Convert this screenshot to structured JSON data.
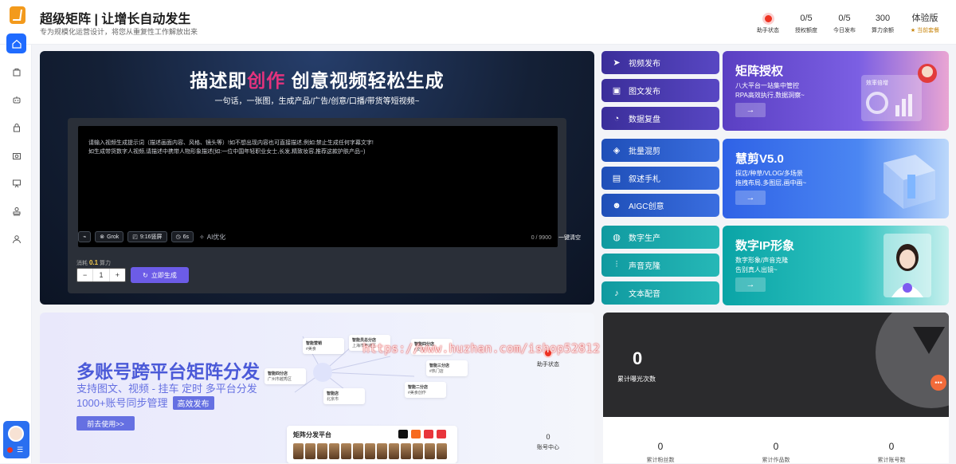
{
  "header": {
    "title": "超级矩阵 | 让增长自动发生",
    "subtitle": "专为规模化运营设计，将您从重复性工作解放出来",
    "stats": [
      {
        "value": "",
        "label": "助手状态"
      },
      {
        "value": "0/5",
        "label": "授权额度"
      },
      {
        "value": "0/5",
        "label": "今日发布"
      },
      {
        "value": "300",
        "label": "算力余额"
      },
      {
        "value": "体验版",
        "label": "当前套餐"
      }
    ]
  },
  "sidebar": {
    "icons": [
      "home-icon",
      "bag-icon",
      "robot-icon",
      "lock-icon",
      "camera-icon",
      "presentation-icon",
      "stamp-icon",
      "user-icon"
    ],
    "menu_glyph": "☰"
  },
  "hero": {
    "title_before": "描述即",
    "title_highlight": "创作",
    "title_after": " 创意视频轻松生成",
    "subtitle": "一句话，一张图，生成产品/广告/创意/口播/带货等短视频~",
    "prompt_line1": "请输入视频生成提示词（描述画面内容、风格、镜头等）!如不想出现内容也可直接描述,例如:禁止生成任何字幕文字!",
    "prompt_line2": "如生成带货数字人视频,请描述中携带人物形象描述(如:一位中国年轻职业女士,长发,精致妆容,推荐这款护肤产品~)",
    "count": "0 / 9900",
    "tools": {
      "model": "Grok",
      "ratio": "9:16竖屏",
      "duration": "6s",
      "ai": "AI优化"
    },
    "clear": "一键清空",
    "cost_prefix": "消耗",
    "cost_value": "0.1",
    "cost_suffix": "算力",
    "qty": "1",
    "minus": "−",
    "plus": "+",
    "generate": "立即生成"
  },
  "features": [
    {
      "label": "视频发布",
      "icon": "send-icon"
    },
    {
      "label": "图文发布",
      "icon": "image-icon"
    },
    {
      "label": "数据复盘",
      "icon": "chart-icon"
    },
    {
      "label": "批量混剪",
      "icon": "layers-icon"
    },
    {
      "label": "叙述手札",
      "icon": "notebook-icon"
    },
    {
      "label": "AIGC创意",
      "icon": "discord-icon"
    },
    {
      "label": "数字生产",
      "icon": "globe-icon"
    },
    {
      "label": "声音克隆",
      "icon": "waveform-icon"
    },
    {
      "label": "文本配音",
      "icon": "microphone-icon"
    }
  ],
  "promos": [
    {
      "title": "矩阵授权",
      "line1": "八大平台一站集中管控",
      "line2": "RPA高效执行,数据洞察~",
      "arrow": "→",
      "art_label": "效率倍增"
    },
    {
      "title": "慧剪V5.0",
      "line1": "探店/种草/VLOG/多场景",
      "line2": "拖拽布局,多图层,画中画~",
      "arrow": "→",
      "art_label": ""
    },
    {
      "title": "数字IP形象",
      "line1": "数字形象/声音克隆",
      "line2": "告别真人出镜~",
      "arrow": "→",
      "art_label": ""
    }
  ],
  "matrix": {
    "title": "多账号跨平台矩阵分发",
    "line1": "支持图文、视频 - 挂车 定时 多平台分发",
    "line2": "1000+账号同步管理",
    "tag": "高效发布",
    "button": "前去使用>>",
    "nodes": [
      {
        "name": "智能营销",
        "tag": "#美食"
      },
      {
        "name": "智能员总分店",
        "tag": "上海市黄浦区"
      },
      {
        "name": "智能四分店",
        "tag": "#文化"
      },
      {
        "name": "智能二分店",
        "tag": "#美食创作"
      },
      {
        "name": "智能四分店",
        "tag": "广州市越秀区"
      },
      {
        "name": "智能店",
        "tag": "北京市"
      },
      {
        "name": "智能三分店",
        "tag": "#热门店"
      }
    ],
    "platform_title": "矩阵分发平台",
    "assistant_status": "助手状态",
    "account_center_value": "0",
    "account_center_label": "账号中心"
  },
  "watermark": "https://www.huzhan.com/ishop52812",
  "exposure": {
    "value": "0",
    "label": "累计曝光次数"
  },
  "bottom_stats": [
    {
      "value": "0",
      "label": "累计粉丝数"
    },
    {
      "value": "0",
      "label": "累计作品数"
    },
    {
      "value": "0",
      "label": "累计账号数"
    }
  ],
  "colors": {
    "accent": "#1f6bff",
    "highlight": "#e4337d",
    "matrix": "#4b5ad8",
    "gold": "#c8860d"
  }
}
